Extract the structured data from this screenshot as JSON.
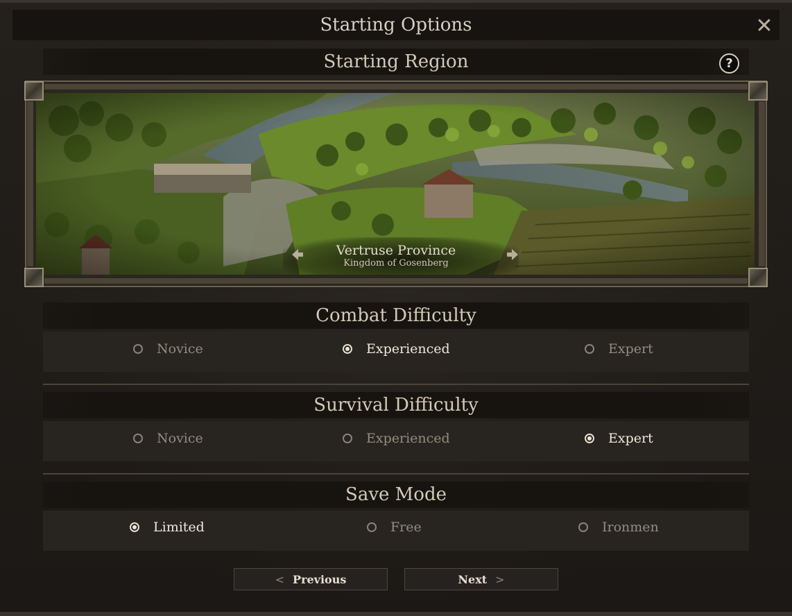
{
  "dialog": {
    "title": "Starting Options",
    "close_icon": "close-icon"
  },
  "region_section": {
    "title": "Starting Region",
    "help_label": "?",
    "region_name": "Vertruse Province",
    "region_subtitle": "Kingdom of Gosenberg",
    "prev_icon": "arrow-left-icon",
    "next_icon": "arrow-right-icon"
  },
  "combat": {
    "title": "Combat Difficulty",
    "options": [
      {
        "label": "Novice",
        "selected": false
      },
      {
        "label": "Experienced",
        "selected": true
      },
      {
        "label": "Expert",
        "selected": false
      }
    ]
  },
  "survival": {
    "title": "Survival Difficulty",
    "options": [
      {
        "label": "Novice",
        "selected": false
      },
      {
        "label": "Experienced",
        "selected": false
      },
      {
        "label": "Expert",
        "selected": true
      }
    ]
  },
  "save_mode": {
    "title": "Save Mode",
    "options": [
      {
        "label": "Limited",
        "selected": true
      },
      {
        "label": "Free",
        "selected": false
      },
      {
        "label": "Ironmen",
        "selected": false
      }
    ]
  },
  "navigation": {
    "previous_label": "Previous",
    "previous_chevron": "<",
    "next_label": "Next",
    "next_chevron": ">"
  },
  "colors": {
    "background": "#1f1c19",
    "header_bar": "#171410",
    "option_row": "#282420",
    "selected_text": "#efe8da",
    "unselected_text": "#948c80"
  }
}
